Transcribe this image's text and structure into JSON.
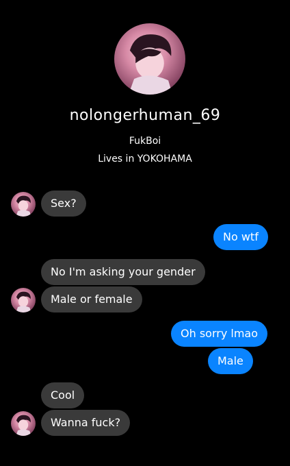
{
  "profile": {
    "username": "nolongerhuman_69",
    "bio_line1": "FukBoi",
    "bio_line2": "Lives in YOKOHAMA"
  },
  "messages": [
    {
      "sender": "them",
      "text": "Sex?"
    },
    {
      "sender": "me",
      "text": "No wtf"
    },
    {
      "sender": "them",
      "text": "No I'm asking your gender"
    },
    {
      "sender": "them",
      "text": "Male or female"
    },
    {
      "sender": "me",
      "text": "Oh sorry lmao"
    },
    {
      "sender": "me",
      "text": "Male"
    },
    {
      "sender": "them",
      "text": "Cool"
    },
    {
      "sender": "them",
      "text": "Wanna fuck?"
    }
  ],
  "colors": {
    "background": "#000000",
    "incoming_bubble": "#3a3a3a",
    "outgoing_bubble": "#0a84ff",
    "text": "#ffffff"
  },
  "icons": {
    "profile_avatar": "profile-avatar-image",
    "sender_avatar": "sender-avatar-image"
  }
}
